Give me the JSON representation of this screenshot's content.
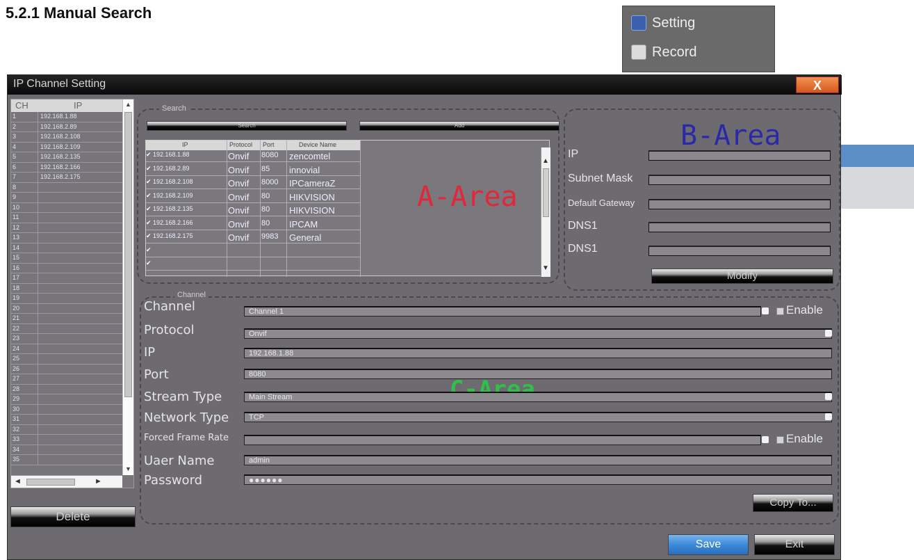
{
  "heading": "5.2.1 Manual Search",
  "context_menu": {
    "items": [
      {
        "label": "Setting",
        "icon": "setting-icon"
      },
      {
        "label": "Record",
        "icon": "record-icon"
      }
    ]
  },
  "window": {
    "title": "IP Channel Setting",
    "close_label": "X"
  },
  "channel_list": {
    "headers": [
      "CH",
      "IP"
    ],
    "rows": [
      {
        "n": "1",
        "ip": "192.168.1.88"
      },
      {
        "n": "2",
        "ip": "192.168.2.89"
      },
      {
        "n": "3",
        "ip": "192.168.2.108"
      },
      {
        "n": "4",
        "ip": "192.168.2.109"
      },
      {
        "n": "5",
        "ip": "192.168.2.135"
      },
      {
        "n": "6",
        "ip": "192.168.2.166"
      },
      {
        "n": "7",
        "ip": "192.168.2.175"
      },
      {
        "n": "8",
        "ip": ""
      },
      {
        "n": "9",
        "ip": ""
      },
      {
        "n": "10",
        "ip": ""
      },
      {
        "n": "11",
        "ip": ""
      },
      {
        "n": "12",
        "ip": ""
      },
      {
        "n": "13",
        "ip": ""
      },
      {
        "n": "14",
        "ip": ""
      },
      {
        "n": "15",
        "ip": ""
      },
      {
        "n": "16",
        "ip": ""
      },
      {
        "n": "17",
        "ip": ""
      },
      {
        "n": "18",
        "ip": ""
      },
      {
        "n": "19",
        "ip": ""
      },
      {
        "n": "20",
        "ip": ""
      },
      {
        "n": "21",
        "ip": ""
      },
      {
        "n": "22",
        "ip": ""
      },
      {
        "n": "23",
        "ip": ""
      },
      {
        "n": "24",
        "ip": ""
      },
      {
        "n": "25",
        "ip": ""
      },
      {
        "n": "26",
        "ip": ""
      },
      {
        "n": "27",
        "ip": ""
      },
      {
        "n": "28",
        "ip": ""
      },
      {
        "n": "29",
        "ip": ""
      },
      {
        "n": "30",
        "ip": ""
      },
      {
        "n": "31",
        "ip": ""
      },
      {
        "n": "32",
        "ip": ""
      },
      {
        "n": "33",
        "ip": ""
      },
      {
        "n": "34",
        "ip": ""
      },
      {
        "n": "35",
        "ip": ""
      }
    ],
    "delete_label": "Delete"
  },
  "search": {
    "group_label": "Search",
    "search_button": "Search",
    "add_button": "Add",
    "table_headers": [
      "IP",
      "Protocol",
      "Port",
      "Device Name"
    ],
    "rows": [
      {
        "ip": "192.168.1.88",
        "protocol": "Onvif",
        "port": "8080",
        "name": "zencomtel"
      },
      {
        "ip": "192.168.2.89",
        "protocol": "Onvif",
        "port": "85",
        "name": "innovial"
      },
      {
        "ip": "192.168.2.108",
        "protocol": "Onvif",
        "port": "8000",
        "name": "IPCameraZ"
      },
      {
        "ip": "192.168.2.109",
        "protocol": "Onvif",
        "port": "80",
        "name": "HIKVISION"
      },
      {
        "ip": "192.168.2.135",
        "protocol": "Onvif",
        "port": "80",
        "name": "HIKVISION"
      },
      {
        "ip": "192.168.2.166",
        "protocol": "Onvif",
        "port": "80",
        "name": "IPCAM"
      },
      {
        "ip": "192.168.2.175",
        "protocol": "Onvif",
        "port": "9983",
        "name": "General"
      },
      {
        "ip": "",
        "protocol": "",
        "port": "",
        "name": ""
      },
      {
        "ip": "",
        "protocol": "",
        "port": "",
        "name": ""
      }
    ],
    "area_label": "A-Area"
  },
  "network": {
    "area_label": "B-Area",
    "fields": [
      {
        "label": "IP"
      },
      {
        "label": "Subnet Mask"
      },
      {
        "label": "Default Gateway"
      },
      {
        "label": "DNS1"
      },
      {
        "label": "DNS1"
      }
    ],
    "modify_label": "Modify"
  },
  "channel": {
    "group_label": "Channel",
    "area_label": "C-Area",
    "labels": {
      "channel": "Channel",
      "protocol": "Protocol",
      "ip": "IP",
      "port": "Port",
      "stream_type": "Stream Type",
      "network_type": "Network Type",
      "forced_frame_rate": "Forced Frame Rate",
      "user_name": "Uaer Name",
      "password": "Password"
    },
    "values": {
      "channel": "Channel 1",
      "protocol": "Onvif",
      "ip": "192.168.1.88",
      "port": "8080",
      "stream_type": "Main Stream",
      "network_type": "TCP",
      "forced_frame_rate": "",
      "user_name": "admin",
      "password": "●●●●●●"
    },
    "enable_label": "Enable",
    "copy_label": "Copy To..."
  },
  "footer": {
    "save_label": "Save",
    "exit_label": "Exit"
  },
  "colors": {
    "window_bg": "#6e6b70",
    "a_area": "#e0283a",
    "b_area": "#2a2aa8",
    "c_area": "#2fbf4a",
    "save_button": "#3c8ad8"
  }
}
